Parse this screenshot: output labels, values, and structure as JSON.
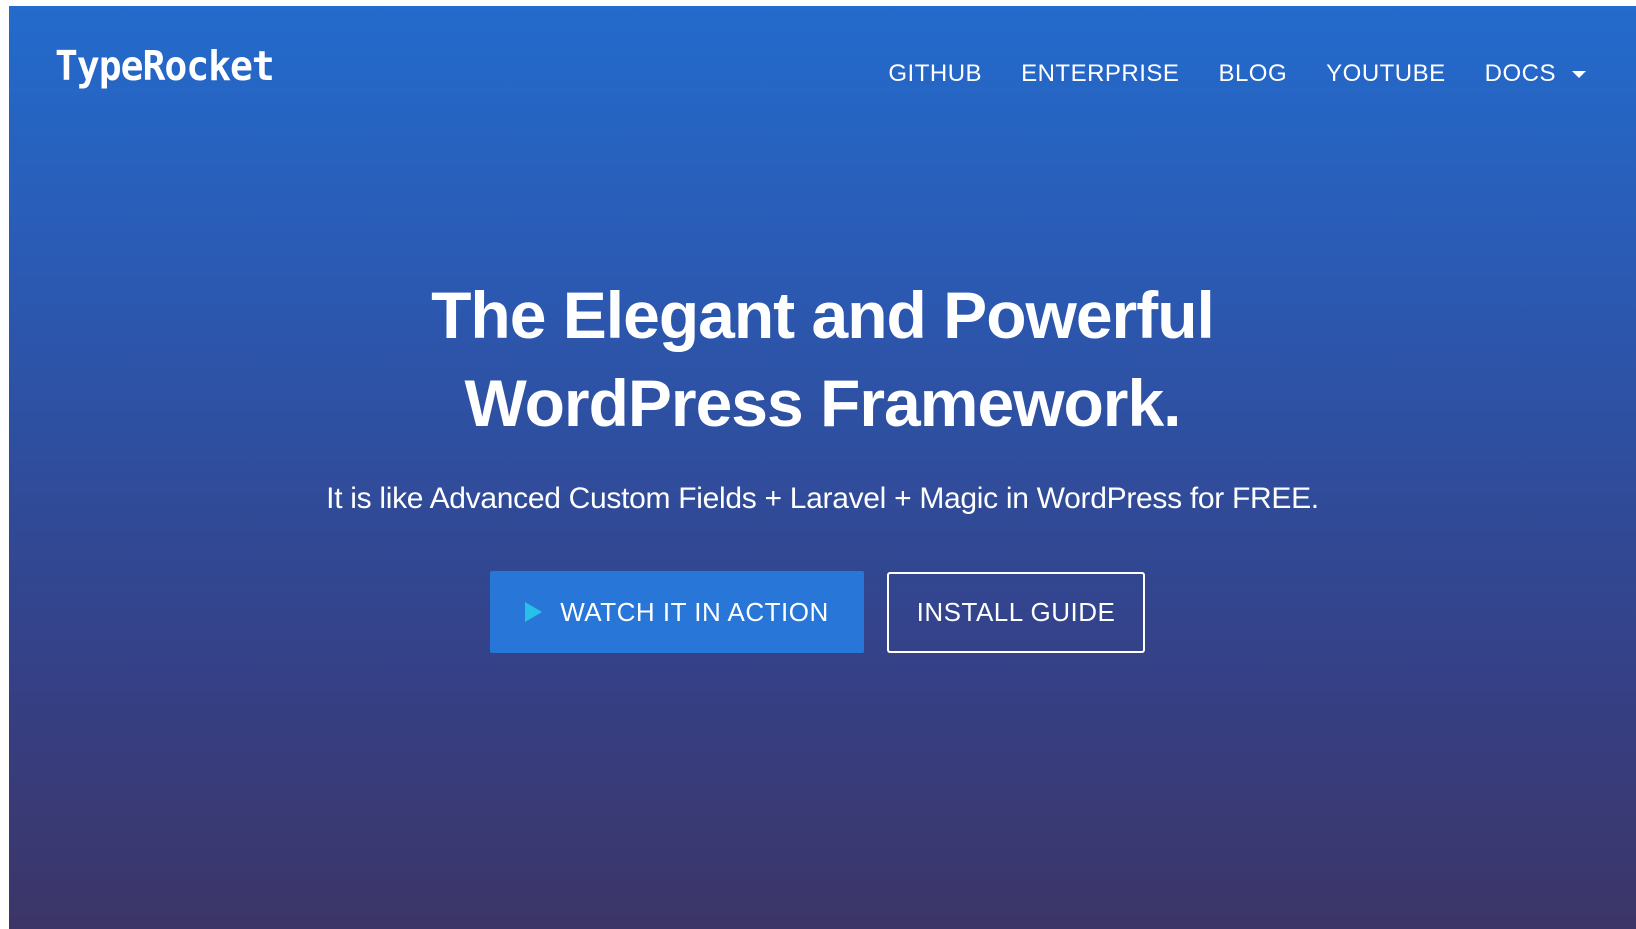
{
  "header": {
    "logo": "TypeRocket",
    "nav": [
      {
        "label": "GITHUB"
      },
      {
        "label": "ENTERPRISE"
      },
      {
        "label": "BLOG"
      },
      {
        "label": "YOUTUBE"
      },
      {
        "label": "DOCS",
        "icon": "caret-down-icon"
      }
    ]
  },
  "hero": {
    "headline_line1": "The Elegant and Powerful",
    "headline_line2": "WordPress Framework.",
    "subline": "It is like Advanced Custom Fields + Laravel + Magic in WordPress for FREE.",
    "primary_button": {
      "label": "WATCH IT IN ACTION",
      "icon": "play-icon"
    },
    "secondary_button": {
      "label": "INSTALL GUIDE"
    }
  },
  "colors": {
    "gradient_top": "#236bcc",
    "gradient_bottom": "#3c3567",
    "primary_button": "#2876d8",
    "play_icon": "#27c0e8",
    "text": "#ffffff"
  }
}
